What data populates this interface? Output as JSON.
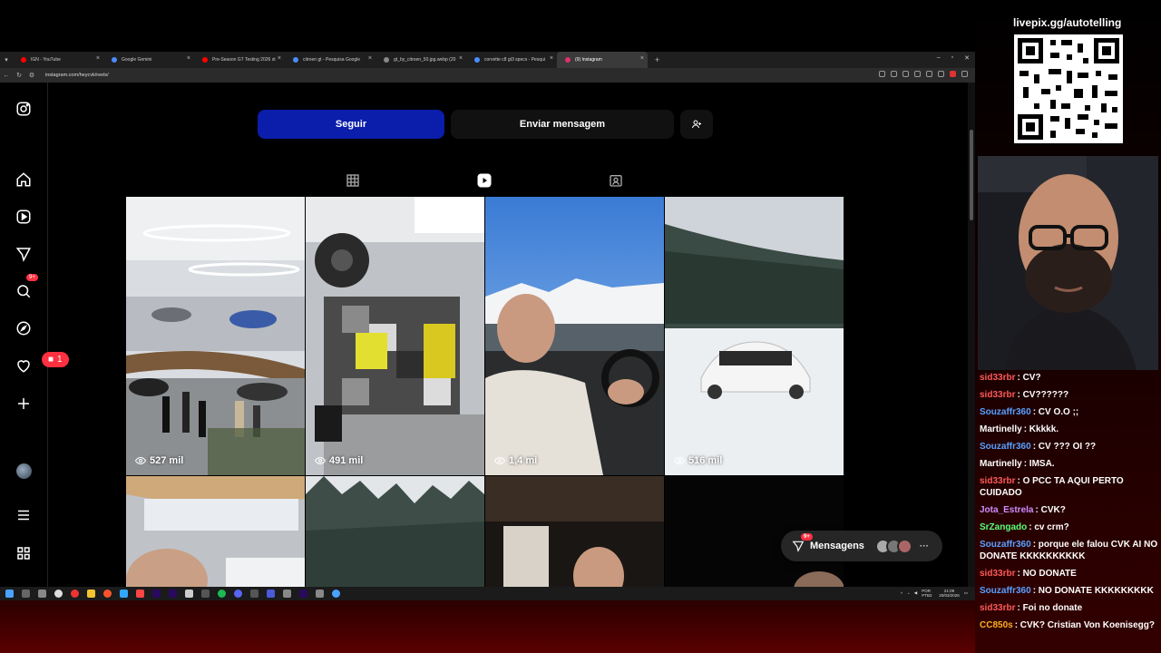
{
  "browser": {
    "tabs": [
      {
        "label": "IGN - YouTube",
        "color": "#ff0000"
      },
      {
        "label": "Google Gemini",
        "color": "#4a8cff"
      },
      {
        "label": "Pre-Season GT Testing 2026 st",
        "color": "#ff0000"
      },
      {
        "label": "citroen gt - Pesquisa Google",
        "color": "#4a8cff"
      },
      {
        "label": "gt_by_citroen_50.jpg.webp (20",
        "color": "#888888"
      },
      {
        "label": "corvette c8 gt3 specs - Pesqui",
        "color": "#4a8cff"
      },
      {
        "label": "(9) Instagram",
        "color": "#e1306c",
        "active": true
      }
    ],
    "url": "instagram.com/heycvk/reels/"
  },
  "instagram": {
    "follow_label": "Seguir",
    "message_label": "Enviar mensagem",
    "sidebar_badge": "9+",
    "notification_count": "1",
    "profile_tabs": [
      "posts-grid",
      "reels",
      "tagged"
    ],
    "reels": [
      {
        "views": "527 mil",
        "scene": "showroom"
      },
      {
        "views": "491 mil",
        "scene": "pixelated"
      },
      {
        "views": "1,4 mi",
        "scene": "driver"
      },
      {
        "views": "516 mil",
        "scene": "snow-car"
      },
      {
        "views": "",
        "scene": "sunroof"
      },
      {
        "views": "",
        "scene": "forest"
      },
      {
        "views": "",
        "scene": "room"
      },
      {
        "views": "",
        "scene": "dark"
      }
    ],
    "messages_label": "Mensagens",
    "messages_badge": "9+"
  },
  "taskbar": {
    "language": "POR PTB2",
    "time": "21:09",
    "date": "20/03/2026"
  },
  "stream": {
    "livepix": "livepix.gg/autotelling",
    "chat": [
      {
        "user": "sid33rbr",
        "color": "#ff5a5a",
        "text": ": CV?"
      },
      {
        "user": "sid33rbr",
        "color": "#ff5a5a",
        "text": ": CV??????"
      },
      {
        "user": "Souzaffr360",
        "color": "#5aa0ff",
        "text": ": CV O.O ;;"
      },
      {
        "user": "Martinelly",
        "color": "#ffffff",
        "text": ": Kkkkk."
      },
      {
        "user": "Souzaffr360",
        "color": "#5aa0ff",
        "text": ": CV ??? OI ??"
      },
      {
        "user": "Martinelly",
        "color": "#ffffff",
        "text": ": IMSA."
      },
      {
        "user": "sid33rbr",
        "color": "#ff5a5a",
        "text": ": O PCC TA AQUI PERTO CUIDADO"
      },
      {
        "user": "Jota_Estrela",
        "color": "#d08cff",
        "text": ": CVK?"
      },
      {
        "user": "SrZangado",
        "color": "#5aff7a",
        "text": ": cv crm?"
      },
      {
        "user": "Souzaffr360",
        "color": "#5aa0ff",
        "text": ": porque ele falou CVK AI NO DONATE KKKKKKKKKK"
      },
      {
        "user": "sid33rbr",
        "color": "#ff5a5a",
        "text": ": NO DONATE"
      },
      {
        "user": "Souzaffr360",
        "color": "#5aa0ff",
        "text": ": NO DONATE KKKKKKKKK"
      },
      {
        "user": "sid33rbr",
        "color": "#ff5a5a",
        "text": ": Foi no donate"
      },
      {
        "user": "CC850s",
        "color": "#ffb020",
        "text": ": CVK? Cristian Von Koenisegg?"
      }
    ]
  }
}
